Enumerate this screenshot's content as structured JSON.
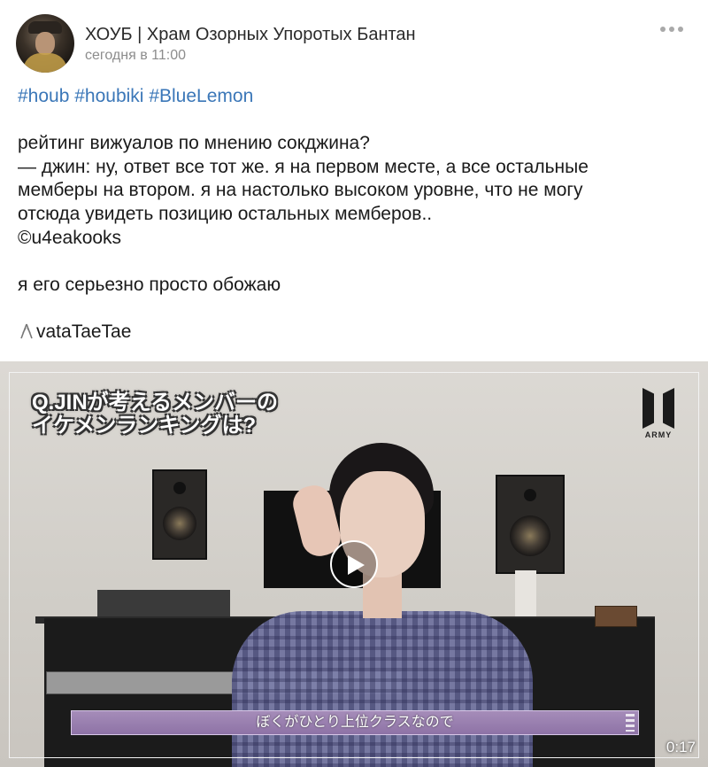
{
  "post": {
    "group_name": "ХОУБ | Храм Озорных Упоротых Бантан",
    "time": "сегодня в 11:00",
    "hashtags": [
      "#houb",
      "#houbiki",
      "#BlueLemon"
    ],
    "text_lines": [
      "рейтинг вижуалов по мнению сокджина?",
      "— джин: ну, ответ все тот же. я на первом месте, а все остальные",
      "мемберы на втором. я на настолько высоком уровне, что не могу",
      "отсюда увидеть позицию остальных мемберов..",
      "©u4eakooks"
    ],
    "comment": "я его серьезно просто обожаю",
    "signature": "vataTaeTae",
    "signature_icon": "kneeling-figure-icon"
  },
  "video": {
    "overlay_title_line1": "Q.JINが考えるメンバーの",
    "overlay_title_line2": "イケメンランキングは?",
    "logo_text": "ARMY",
    "subtitle": "ぼくがひとり上位クラスなので",
    "duration": "0:17",
    "play_icon": "play-icon"
  },
  "colors": {
    "link": "#3b77b8",
    "time": "#8c8c8c",
    "subtitle_bar": "#9a80b0"
  }
}
